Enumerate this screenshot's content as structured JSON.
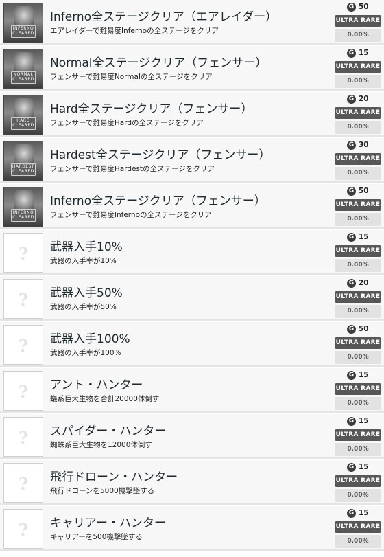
{
  "achievements": [
    {
      "title": "Inferno全ステージクリア（エアレイダー）",
      "desc": "エアレイダーで難易度Infernoの全ステージをクリア",
      "points": "50",
      "rarity": "ULTRA RARE",
      "percent": "0.00%",
      "locked": false,
      "plate": "INFERNO CLEARED"
    },
    {
      "title": "Normal全ステージクリア（フェンサー）",
      "desc": "フェンサーで難易度Normalの全ステージをクリア",
      "points": "15",
      "rarity": "ULTRA RARE",
      "percent": "0.00%",
      "locked": false,
      "plate": "NORMAL CLEARED"
    },
    {
      "title": "Hard全ステージクリア（フェンサー）",
      "desc": "フェンサーで難易度Hardの全ステージをクリア",
      "points": "20",
      "rarity": "ULTRA RARE",
      "percent": "0.00%",
      "locked": false,
      "plate": "HARD CLEARED"
    },
    {
      "title": "Hardest全ステージクリア（フェンサー）",
      "desc": "フェンサーで難易度Hardestの全ステージをクリア",
      "points": "30",
      "rarity": "ULTRA RARE",
      "percent": "0.00%",
      "locked": false,
      "plate": "HARDEST CLEARED"
    },
    {
      "title": "Inferno全ステージクリア（フェンサー）",
      "desc": "フェンサーで難易度Infernoの全ステージをクリア",
      "points": "50",
      "rarity": "ULTRA RARE",
      "percent": "0.00%",
      "locked": false,
      "plate": "INFERNO CLEARED"
    },
    {
      "title": "武器入手10%",
      "desc": "武器の入手率が10%",
      "points": "15",
      "rarity": "ULTRA RARE",
      "percent": "0.00%",
      "locked": true
    },
    {
      "title": "武器入手50%",
      "desc": "武器の入手率が50%",
      "points": "20",
      "rarity": "ULTRA RARE",
      "percent": "0.00%",
      "locked": true
    },
    {
      "title": "武器入手100%",
      "desc": "武器の入手率が100%",
      "points": "50",
      "rarity": "ULTRA RARE",
      "percent": "0.00%",
      "locked": true
    },
    {
      "title": "アント・ハンター",
      "desc": "蟻系巨大生物を合計20000体倒す",
      "points": "15",
      "rarity": "ULTRA RARE",
      "percent": "0.00%",
      "locked": true
    },
    {
      "title": "スパイダー・ハンター",
      "desc": "蜘蛛系巨大生物を12000体倒す",
      "points": "15",
      "rarity": "ULTRA RARE",
      "percent": "0.00%",
      "locked": true
    },
    {
      "title": "飛行ドローン・ハンター",
      "desc": "飛行ドローンを5000機撃墜する",
      "points": "15",
      "rarity": "ULTRA RARE",
      "percent": "0.00%",
      "locked": true
    },
    {
      "title": "キャリアー・ハンター",
      "desc": "キャリアーを500機撃墜する",
      "points": "15",
      "rarity": "ULTRA RARE",
      "percent": "0.00%",
      "locked": true
    }
  ],
  "icons": {
    "points": "g-coin-icon",
    "locked": "question-mark-icon"
  },
  "points_badge": "G",
  "colors": {
    "rarity_bg": "#575757",
    "percent_bg": "#e2e2e2",
    "row_bg": "#f7f7f7"
  }
}
